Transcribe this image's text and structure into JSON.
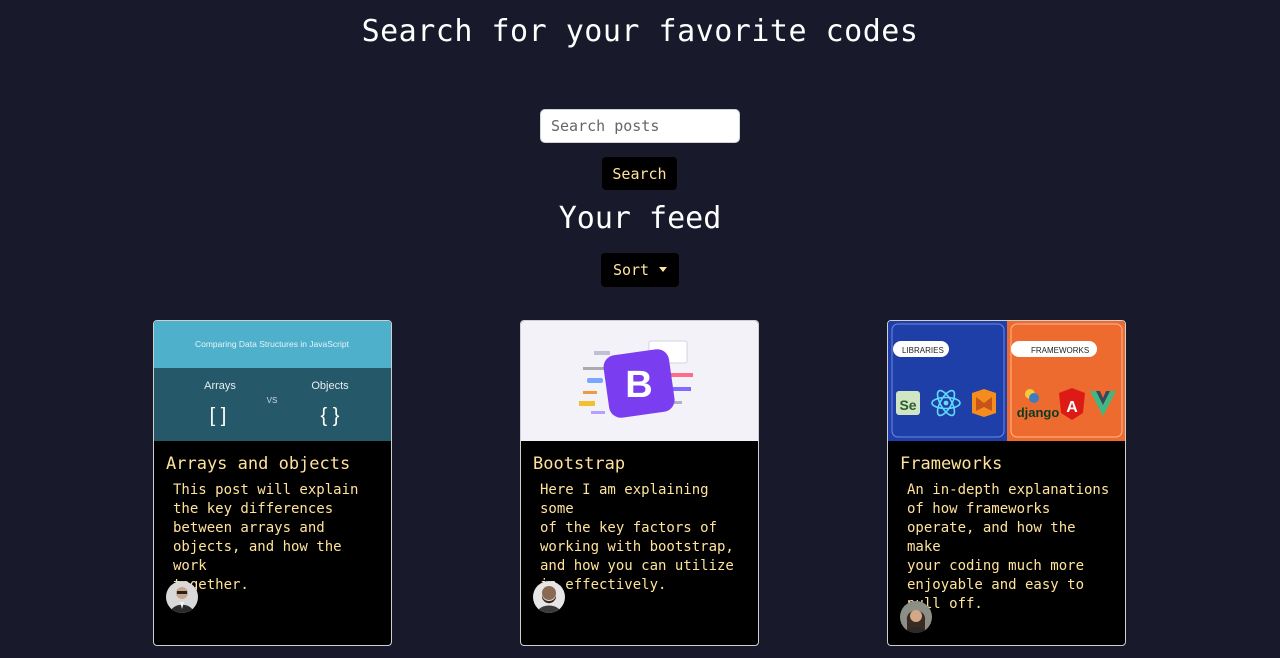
{
  "header": {
    "title": "Search for your favorite codes"
  },
  "search": {
    "placeholder": "Search posts",
    "button_label": "Search"
  },
  "feed": {
    "title": "Your feed",
    "sort_label": "Sort"
  },
  "cards": [
    {
      "title": "Arrays and objects",
      "text": "This post will explain\nthe key differences\nbetween arrays and\nobjects, and how the work\ntogether.",
      "image": {
        "heading": "Comparing Data Structures in JavaScript",
        "left_label": "Arrays",
        "vs": "VS",
        "right_label": "Objects",
        "left_symbol": "[ ]",
        "right_symbol": "{ }"
      }
    },
    {
      "title": "Bootstrap",
      "text": "Here I am explaining some\nof the key factors of\nworking with bootstrap,\nand how you can utilize\nis effectively.",
      "image": {
        "logo_letter": "B"
      }
    },
    {
      "title": "Frameworks",
      "text": "An in-depth explanations\nof how frameworks\noperate, and how the make\nyour coding much more\nenjoyable and easy to\npull off.",
      "image": {
        "left_tag": "LIBRARIES",
        "right_tag": "FRAMEWORKS",
        "selenium": "Se",
        "django": "django",
        "angular": "A",
        "vue": "V"
      }
    }
  ],
  "colors": {
    "background": "#181a2b",
    "accent_text": "#ffe39a",
    "button_bg": "#000000"
  }
}
